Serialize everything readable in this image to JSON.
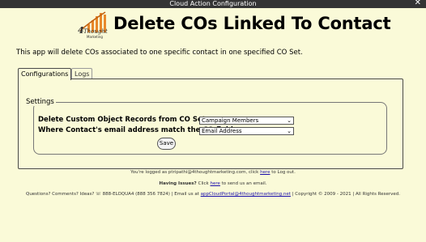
{
  "window": {
    "title": "Cloud Action Configuration",
    "close_symbol": "✕"
  },
  "header": {
    "logo_text": "4Thought Marketing",
    "title": "Delete COs Linked To Contact"
  },
  "intro": "This app will delete COs associated to one specific contact in one specified CO Set.",
  "tabs": [
    {
      "label": "Configurations",
      "active": true
    },
    {
      "label": "Logs",
      "active": false
    }
  ],
  "settings": {
    "legend": "Settings",
    "rows": [
      {
        "label": "Delete Custom Object Records from CO Set",
        "selected": "Campaign Members"
      },
      {
        "label": "Where Contact's email address match the CO field",
        "selected": "Email Address"
      }
    ],
    "save_label": "Save"
  },
  "footer": {
    "logged_prefix": "You're logged as ptripathi@4thoughtmarketing.com, click ",
    "logged_link": "here",
    "logged_suffix": " to Log out.",
    "issues_prefix": "Having Issues? ",
    "issues_mid": "Click ",
    "issues_link": "here",
    "issues_suffix": " to send us an email.",
    "contact_prefix": "Questions? Comments? Ideas? ☏ 888-ELOQUA4 (888 356 7824) | Email us at ",
    "contact_link": "appCloudPortal@4thoughtmarketing.net",
    "contact_suffix": " | Copyright © 2009 - 2021 | All Rights Reserved."
  },
  "colors": {
    "background": "#fafad8",
    "titlebar": "#353535",
    "logo_orange": "#e8892b",
    "link": "#1a0dab"
  }
}
